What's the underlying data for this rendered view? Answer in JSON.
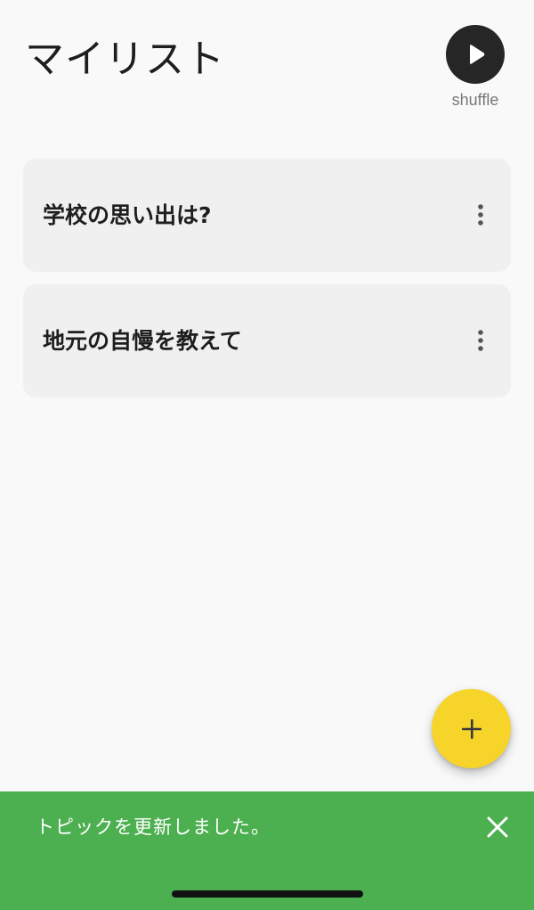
{
  "header": {
    "title": "マイリスト",
    "shuffle_label": "shuffle",
    "shuffle_icon": "play-icon"
  },
  "topics": [
    {
      "title": "学校の思い出は?",
      "menu_icon": "more-vertical-icon"
    },
    {
      "title": "地元の自慢を教えて",
      "menu_icon": "more-vertical-icon"
    }
  ],
  "fab": {
    "icon": "plus-icon",
    "color": "#f7d42a"
  },
  "snackbar": {
    "message": "トピックを更新しました。",
    "close_icon": "close-icon",
    "color": "#4caf50"
  }
}
